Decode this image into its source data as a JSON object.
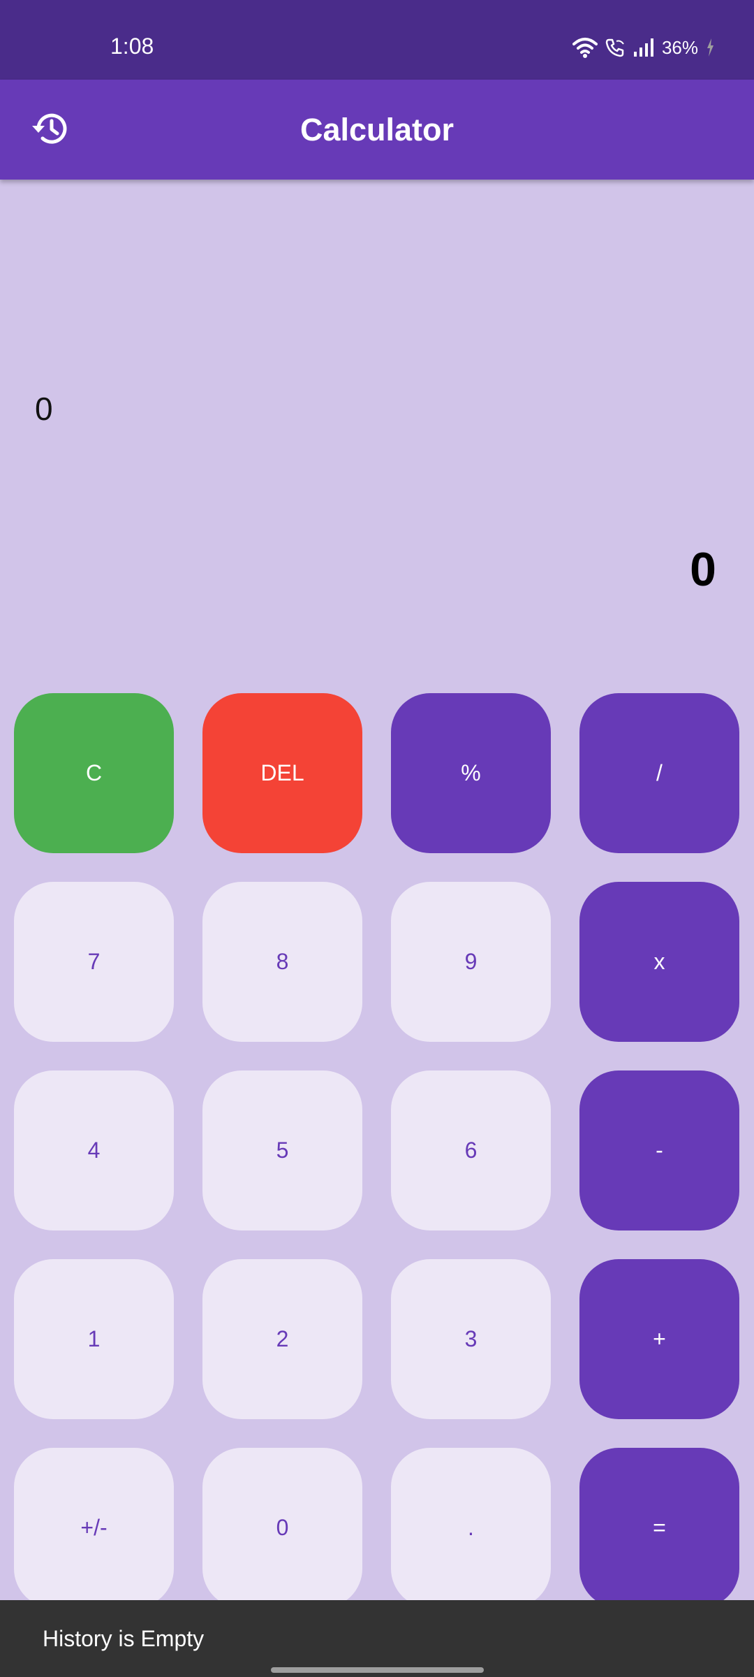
{
  "status_bar": {
    "time": "1:08",
    "battery": "36%",
    "icons": [
      "wifi-icon",
      "wifi-calling-icon",
      "signal-icon",
      "charging-icon"
    ]
  },
  "app_bar": {
    "title": "Calculator",
    "history_icon": "history-icon"
  },
  "display": {
    "expression": "0",
    "result": "0"
  },
  "keys": {
    "clear": "C",
    "delete": "DEL",
    "percent": "%",
    "divide": "/",
    "seven": "7",
    "eight": "8",
    "nine": "9",
    "multiply": "x",
    "four": "4",
    "five": "5",
    "six": "6",
    "subtract": "-",
    "one": "1",
    "two": "2",
    "three": "3",
    "add": "+",
    "sign": "+/-",
    "zero": "0",
    "decimal": ".",
    "equals": "="
  },
  "snackbar": {
    "message": "History is Empty"
  },
  "colors": {
    "status_bar": "#4a2c8a",
    "primary": "#673ab7",
    "background": "#d1c4e9",
    "number_key": "#ede7f6",
    "clear_key": "#4caf50",
    "delete_key": "#f44336",
    "snackbar": "#333333"
  }
}
